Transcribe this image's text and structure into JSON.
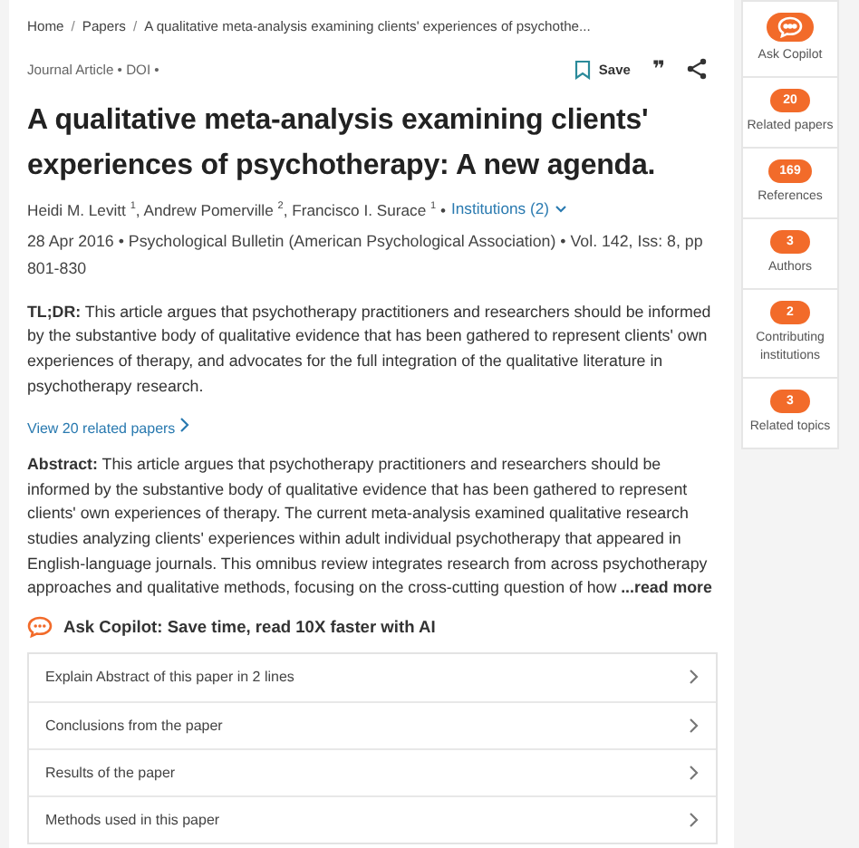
{
  "breadcrumb": [
    "Home",
    "Papers",
    "A qualitative meta-analysis examining clients' experiences of psychothe..."
  ],
  "breadcrumb_separator": "/",
  "meta": "Journal Article • DOI •",
  "actions": {
    "save": "Save",
    "cite": "❞"
  },
  "title": "A qualitative meta-analysis examining clients' experiences of psychotherapy: A new agenda.",
  "authors": "Heidi M. Levitt $^{1}$, Andrew Pomerville $^{2}$, Francisco I. Surace $^{1}$ •",
  "institutions_link": "Institutions (2)",
  "publication": "28 Apr 2016 • Psychological Bulletin (American Psychological Association) • Vol. 142, Iss: 8, pp 801-830",
  "tldr": "**TL;DR:** This article argues that psychotherapy practitioners and researchers should be informed by the substantive body of qualitative evidence that has been gathered to represent clients' own experiences of therapy, and advocates for the full integration of the qualitative literature in psychotherapy research.",
  "related_link": "View 20 related papers",
  "abstract": "**Abstract:** This article argues that psychotherapy practitioners and researchers should be informed by the substantive body of qualitative evidence that has been gathered to represent clients' own experiences of therapy. The current meta-analysis examined qualitative research studies analyzing clients' experiences within adult individual psychotherapy that appeared in English-language journals. This omnibus review integrates research from across psychotherapy approaches and qualitative methods, focusing on the cross-cutting question of how",
  "read_more": "...read more",
  "copilot_heading": "Ask Copilot: Save time, read 10X faster with AI",
  "prompts": [
    "Explain Abstract of this paper in 2 lines",
    "Conclusions from the paper",
    "Results of the paper",
    "Methods used in this paper"
  ],
  "sidebar": [
    {
      "kind": "icon",
      "label": "Ask Copilot"
    },
    {
      "kind": "count",
      "count": "20",
      "label": "Related papers"
    },
    {
      "kind": "count",
      "count": "169",
      "label": "References"
    },
    {
      "kind": "count",
      "count": "3",
      "label": "Authors"
    },
    {
      "kind": "count",
      "count": "2",
      "label": "Contributing institutions"
    },
    {
      "kind": "count",
      "count": "3",
      "label": "Related topics"
    }
  ]
}
